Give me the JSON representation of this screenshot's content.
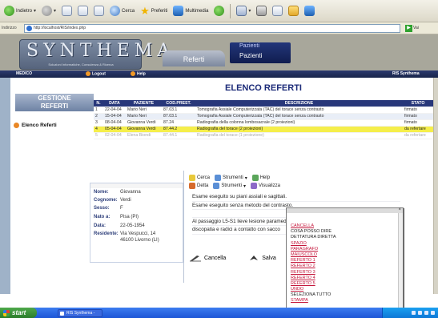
{
  "browser": {
    "toolbar": {
      "back_label": "Indietro",
      "search_label": "Cerca",
      "favorites_label": "Preferiti",
      "media_label": "Multimedia"
    },
    "address": {
      "label": "Indirizzo",
      "url": "http://localhost/RIS/index.php",
      "go_label": "Vai"
    }
  },
  "header": {
    "logo_text": "SYNTHEMA",
    "logo_sub": "Soluzioni Informatiche, Consulenza & Ricerca",
    "tab_pazienti_top": "Pazienti",
    "tab_pazienti": "Pazienti",
    "tab_referti": "Referti",
    "strip_medico": "MEDICO",
    "strip_logout": "Logout",
    "strip_help": "Help",
    "strip_right": "RIS Synthema"
  },
  "sidebar": {
    "banner_line1": "GESTIONE",
    "banner_line2": "REFERTI",
    "item_label": "Elenco Referti"
  },
  "list": {
    "title": "ELENCO REFERTI",
    "columns": [
      "N.",
      "DATA",
      "PAZIENTE",
      "COD.PREST.",
      "DESCRIZIONE",
      "STATO"
    ],
    "rows": [
      {
        "n": "1",
        "data": "22-04-04",
        "paziente": "Mario Neri",
        "cod": "87.03.1",
        "desc": "Tomografia Assiale Computerizzata (TAC) del torace senza contrasto",
        "stato": "firmato"
      },
      {
        "n": "2",
        "data": "15-04-04",
        "paziente": "Mario Neri",
        "cod": "87.03.1",
        "desc": "Tomografia Assiale Computerizzata (TAC) del torace senza contrasto",
        "stato": "firmato"
      },
      {
        "n": "3",
        "data": "08-04-04",
        "paziente": "Giovanna Verdi",
        "cod": "87.24",
        "desc": "Radiografia della colonna lombosacrale (2 proiezioni)",
        "stato": "firmato"
      },
      {
        "n": "4",
        "data": "05-04-04",
        "paziente": "Giovanna Verdi",
        "cod": "87.44.2",
        "desc": "Radiografia del torace (2 proiezioni)",
        "stato": "da refertare"
      },
      {
        "n": "5",
        "data": "02-04-04",
        "paziente": "Elena Biondi",
        "cod": "87.44.1",
        "desc": "Radiografia del torace (1 proiezione)",
        "stato": "da refertare"
      }
    ]
  },
  "patient": {
    "fields": [
      {
        "label": "Nome:",
        "value": "Giovanna"
      },
      {
        "label": "Cognome:",
        "value": "Verdi"
      },
      {
        "label": "Sesso:",
        "value": "F"
      },
      {
        "label": "Nato a:",
        "value": "Pisa (PI)"
      },
      {
        "label": "Data:",
        "value": "22-05-1954"
      },
      {
        "label": "Residente:",
        "value": "Via Vespucci, 14"
      },
      {
        "label": "",
        "value": "46100 Livorno (LI)"
      }
    ]
  },
  "editor": {
    "toolbar_row1": [
      "Cerca",
      "Strumenti",
      "Help"
    ],
    "toolbar_row2": [
      "Detta",
      "Strumenti",
      "Visualizza"
    ],
    "lines": [
      "Esame eseguito su piani assiali e sagittali.",
      "Esame eseguito senza metodo del contrasto.",
      "",
      "Al passaggio L5-S1 lieve lesione paramediana",
      "discopatia e radici a contatto con sacco"
    ],
    "cancel_label": "Cancella",
    "save_label": "Salva"
  },
  "context_menu": {
    "items": [
      {
        "label": "CANCELLA",
        "style": "red"
      },
      {
        "label": "COSA POSSO DIRE",
        "style": "black"
      },
      {
        "label": "DETTATURA DIRETTA",
        "style": "black"
      },
      {
        "label": "SPAZIO",
        "style": "red"
      },
      {
        "label": "PARAGRAFO",
        "style": "red"
      },
      {
        "label": "MAIUSCOLO",
        "style": "red"
      },
      {
        "label": "REFERTO 1",
        "style": "red"
      },
      {
        "label": "REFERTO 2",
        "style": "red"
      },
      {
        "label": "REFERTO 3",
        "style": "red"
      },
      {
        "label": "REFERTO 4",
        "style": "red"
      },
      {
        "label": "REFERTO 5",
        "style": "red"
      },
      {
        "label": "UNDO",
        "style": "red"
      },
      {
        "label": "SELEZIONA TUTTO",
        "style": "black"
      },
      {
        "label": "STAMPA",
        "style": "red"
      }
    ]
  },
  "taskbar": {
    "start_label": "start",
    "task_label": "RIS Synthema - Micro..."
  },
  "colors": {
    "header_navy": "#28377a",
    "selected_row": "#f5ee4a",
    "menu_red": "#c4163b"
  }
}
